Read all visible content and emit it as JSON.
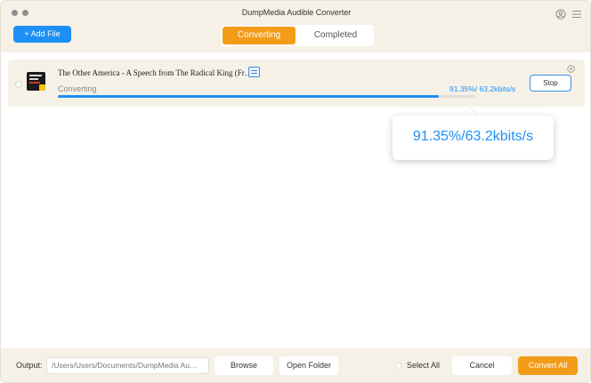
{
  "window": {
    "title": "DumpMedia Audible Converter"
  },
  "toolbar": {
    "add_file_label": "+ Add File"
  },
  "tabs": [
    {
      "label": "Converting",
      "active": true
    },
    {
      "label": "Completed",
      "active": false
    }
  ],
  "task": {
    "title": "The Other America - A Speech from The Radical King (Fr…",
    "status": "Converting",
    "progress_text": "91.35%/ 63.2kbits/s",
    "progress_percent": 91.35,
    "stop_label": "Stop"
  },
  "callout": {
    "text": "91.35%/63.2kbits/s"
  },
  "footer": {
    "output_label": "Output:",
    "output_path": "/Users/Users/Documents/DumpMedia Au…",
    "browse_label": "Browse",
    "open_folder_label": "Open Folder",
    "select_all_label": "Select All",
    "cancel_label": "Cancel",
    "convert_all_label": "Convert All"
  },
  "colors": {
    "accent_blue": "#1e8ff5",
    "accent_orange": "#f39c18",
    "panel_beige": "#f6f1e7"
  },
  "icons": [
    "user-icon",
    "menu-icon",
    "file-info-icon",
    "close-icon",
    "album-cover"
  ]
}
